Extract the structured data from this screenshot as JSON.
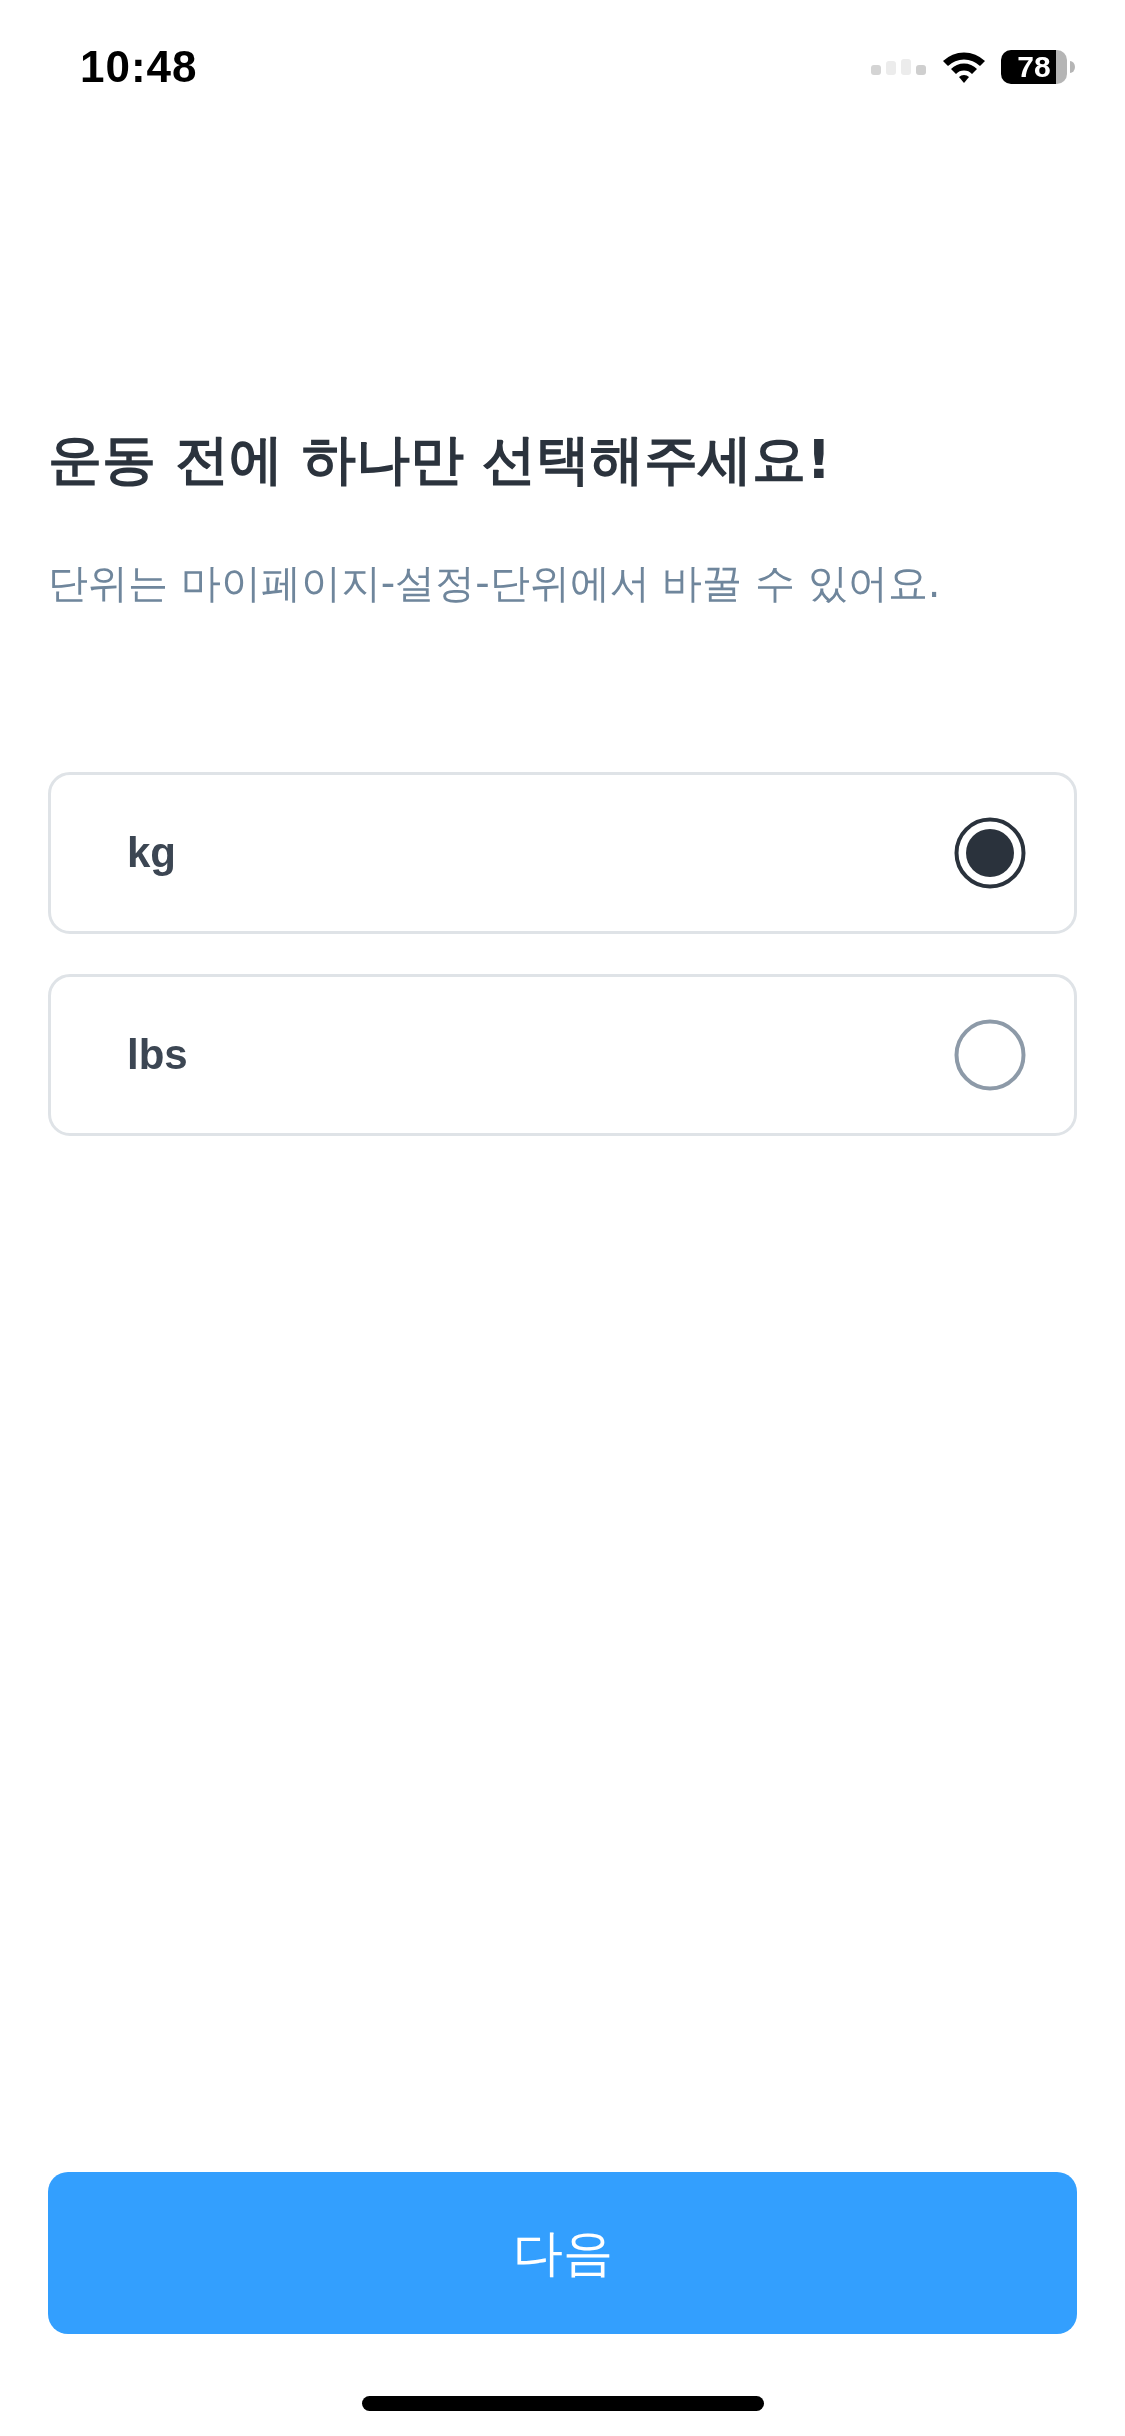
{
  "status_bar": {
    "time": "10:48",
    "battery": "78"
  },
  "header": {
    "title": "운동 전에 하나만 선택해주세요!",
    "subtitle": "단위는 마이페이지-설정-단위에서 바꿀 수 있어요."
  },
  "options": [
    {
      "label": "kg",
      "selected": true
    },
    {
      "label": "lbs",
      "selected": false
    }
  ],
  "next_button": {
    "label": "다음"
  }
}
